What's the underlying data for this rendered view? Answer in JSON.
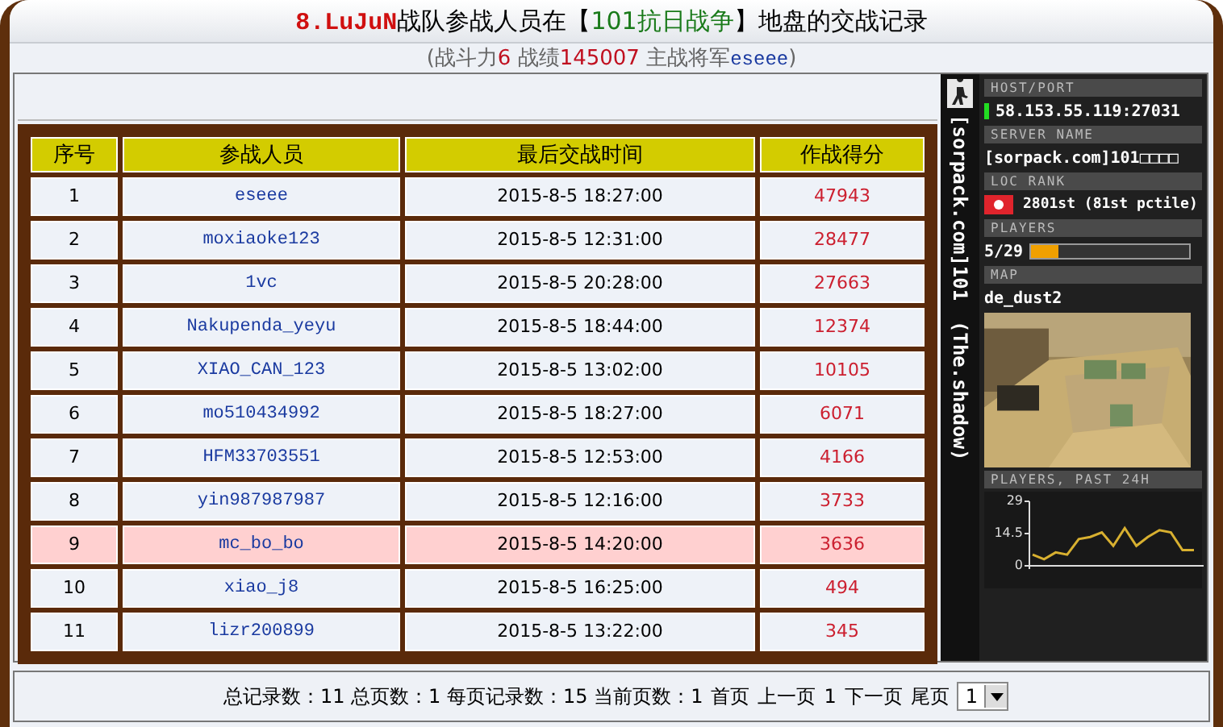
{
  "title": [
    {
      "kind": "team",
      "text": "8.LuJuN"
    },
    {
      "kind": "plain",
      "text": "战队参战人员在【"
    },
    {
      "kind": "territory",
      "text": "101抗日战争"
    },
    {
      "kind": "plain",
      "text": "】地盘的交战记录"
    }
  ],
  "subtitle": [
    {
      "kind": "plain",
      "text": "(战斗力"
    },
    {
      "kind": "number",
      "text": "6"
    },
    {
      "kind": "plain",
      "text": " 战绩"
    },
    {
      "kind": "number",
      "text": "145007"
    },
    {
      "kind": "plain",
      "text": " 主战将军"
    },
    {
      "kind": "name",
      "text": "eseee"
    },
    {
      "kind": "plain",
      "text": ")"
    }
  ],
  "table": {
    "columns": [
      "序号",
      "参战人员",
      "最后交战时间",
      "作战得分"
    ],
    "rows": [
      {
        "no": "1",
        "player": "eseee",
        "time": "2015-8-5 18:27:00",
        "score": "47943",
        "highlighted": false
      },
      {
        "no": "2",
        "player": "moxiaoke123",
        "time": "2015-8-5 12:31:00",
        "score": "28477",
        "highlighted": false
      },
      {
        "no": "3",
        "player": "1vc",
        "time": "2015-8-5 20:28:00",
        "score": "27663",
        "highlighted": false
      },
      {
        "no": "4",
        "player": "Nakupenda_yeyu",
        "time": "2015-8-5 18:44:00",
        "score": "12374",
        "highlighted": false
      },
      {
        "no": "5",
        "player": "XIAO_CAN_123",
        "time": "2015-8-5 13:02:00",
        "score": "10105",
        "highlighted": false
      },
      {
        "no": "6",
        "player": "mo510434992",
        "time": "2015-8-5 18:27:00",
        "score": "6071",
        "highlighted": false
      },
      {
        "no": "7",
        "player": "HFM33703551",
        "time": "2015-8-5 12:53:00",
        "score": "4166",
        "highlighted": false
      },
      {
        "no": "8",
        "player": "yin987987987",
        "time": "2015-8-5 12:16:00",
        "score": "3733",
        "highlighted": false
      },
      {
        "no": "9",
        "player": "mc_bo_bo",
        "time": "2015-8-5 14:20:00",
        "score": "3636",
        "highlighted": true
      },
      {
        "no": "10",
        "player": "xiao_j8",
        "time": "2015-8-5 16:25:00",
        "score": "494",
        "highlighted": false
      },
      {
        "no": "11",
        "player": "lizr200899",
        "time": "2015-8-5 13:22:00",
        "score": "345",
        "highlighted": false
      }
    ]
  },
  "server_banner": {
    "vertical_name": "[sorpack.com]101",
    "vertical_tag": "(The.shadow)",
    "host_label": "HOST/PORT",
    "host": "58.153.55.119:27031",
    "name_label": "SERVER NAME",
    "name": "[sorpack.com]101□□□□",
    "rank_label": "LOC   RANK",
    "rank": "2801st (81st pctile)",
    "players_label": "PLAYERS",
    "players": "5/29",
    "players_bar": {
      "level": 0.17
    },
    "map_label": "MAP",
    "map": "de_dust2",
    "history_label": "PLAYERS, PAST 24H",
    "chart_data": {
      "type": "line",
      "yticks": [
        0,
        14.5,
        29
      ],
      "ylim": [
        0,
        29
      ],
      "series": [
        {
          "color": "#d8b030",
          "values": [
            5,
            3,
            6,
            5,
            12,
            13,
            15,
            9,
            17,
            9,
            13,
            16,
            15,
            7,
            7
          ]
        }
      ]
    }
  },
  "footer": {
    "summary": "总记录数：11 总页数：1 每页记录数：15 当前页数：1",
    "pager": [
      "首页",
      "上一页",
      "1",
      "下一页",
      "尾页"
    ],
    "page_select": "1"
  }
}
